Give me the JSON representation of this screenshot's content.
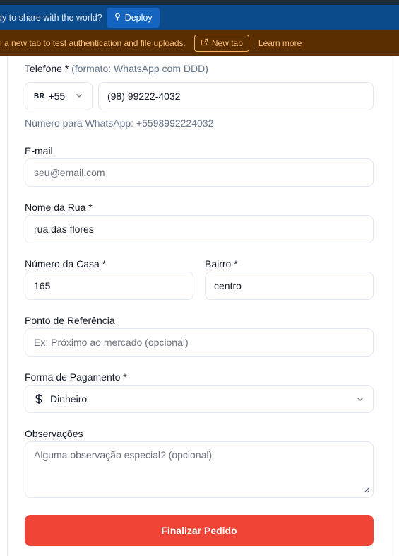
{
  "deploy_bar": {
    "message": "dy to share with the world?",
    "deploy_label": "Deploy"
  },
  "warning_bar": {
    "message": "n a new tab to test authentication and file uploads.",
    "new_tab_label": "New tab",
    "learn_more_label": "Learn more"
  },
  "form": {
    "phone": {
      "label": "Telefone *",
      "hint": "(formato: WhatsApp com DDD)",
      "country_flag": "BR",
      "country_code": "+55",
      "value": "(98) 99222-4032",
      "helper": "Número para WhatsApp: +5598992224032"
    },
    "email": {
      "label": "E-mail",
      "placeholder": "seu@email.com",
      "value": ""
    },
    "street": {
      "label": "Nome da Rua *",
      "value": "rua das flores"
    },
    "house_number": {
      "label": "Número da Casa *",
      "value": "165"
    },
    "neighborhood": {
      "label": "Bairro *",
      "value": "centro"
    },
    "reference": {
      "label": "Ponto de Referência",
      "placeholder": "Ex: Próximo ao mercado (opcional)",
      "value": ""
    },
    "payment": {
      "label": "Forma de Pagamento *",
      "icon": "dollar-icon",
      "selected": "Dinheiro"
    },
    "notes": {
      "label": "Observações",
      "placeholder": "Alguma observação especial? (opcional)",
      "value": ""
    },
    "submit_label": "Finalizar Pedido"
  },
  "colors": {
    "deploy_bar_bg": "#0b4a8b",
    "warning_bar_bg": "#5b2e00",
    "warning_text": "#fbbf77",
    "submit_bg": "#f04437"
  }
}
